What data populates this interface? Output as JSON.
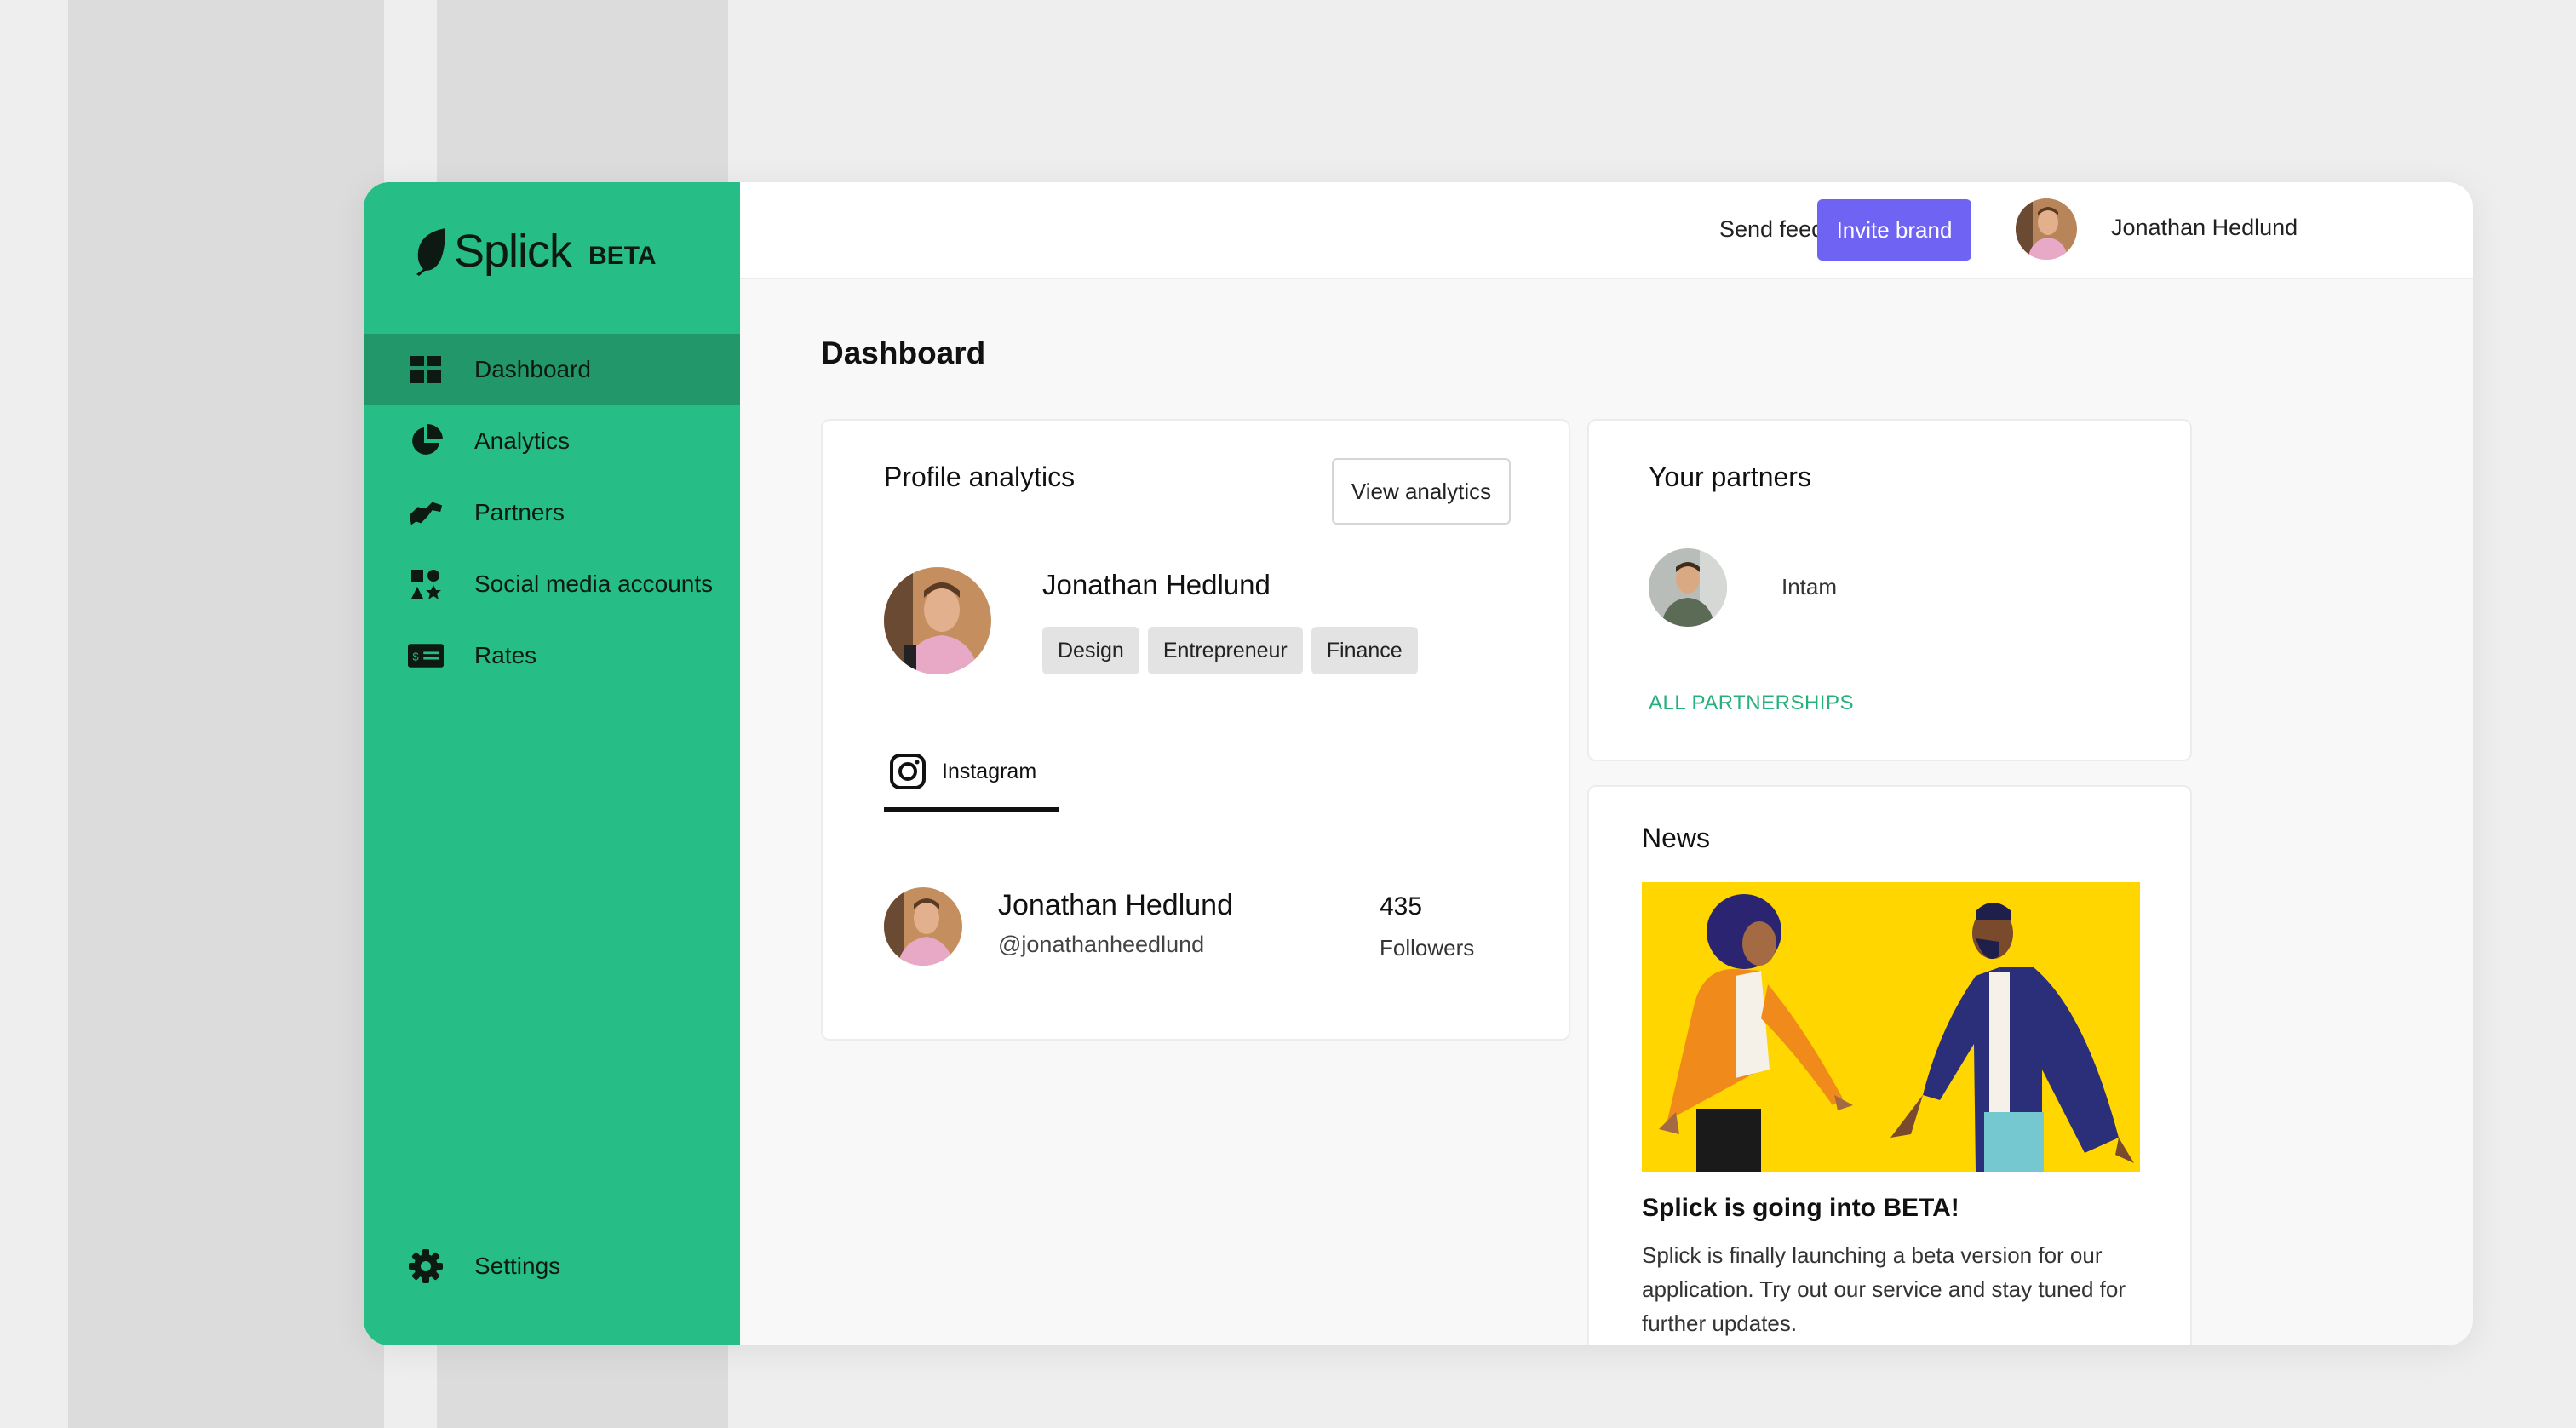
{
  "sidebar": {
    "logo": "Splick",
    "badge": "BETA",
    "items": [
      {
        "label": "Dashboard",
        "icon": "dashboard-icon",
        "active": true
      },
      {
        "label": "Analytics",
        "icon": "pie-chart-icon"
      },
      {
        "label": "Partners",
        "icon": "handshake-icon"
      },
      {
        "label": "Social media accounts",
        "icon": "social-media-icon"
      },
      {
        "label": "Rates",
        "icon": "money-card-icon"
      }
    ],
    "settings": {
      "label": "Settings",
      "icon": "gear-icon"
    }
  },
  "topbar": {
    "feedback": "Send feedback!",
    "invite": "Invite brand",
    "user": "Jonathan Hedlund"
  },
  "main": {
    "title": "Dashboard",
    "profile": {
      "title": "Profile analytics",
      "view_button": "View analytics",
      "name": "Jonathan Hedlund",
      "tags": [
        "Design",
        "Entrepreneur",
        "Finance"
      ],
      "tab": "Instagram",
      "account": {
        "name": "Jonathan Hedlund",
        "handle": "@jonathanheedlund",
        "followers": "435",
        "followers_label": "Followers"
      }
    },
    "partners": {
      "title": "Your partners",
      "items": [
        {
          "name": "Intam"
        }
      ],
      "link": "ALL PARTNERSHIPS"
    },
    "news": {
      "title": "News",
      "headline": "Splick is going into BETA!",
      "body": "Splick is finally launching a beta version for our application. Try out our service and stay tuned for further updates."
    }
  },
  "colors": {
    "sidebar": "#27bd86",
    "sidebar_active": "#229769",
    "accent": "#6f63f3",
    "link": "#26b07b",
    "news_bg": "#ffd600"
  }
}
